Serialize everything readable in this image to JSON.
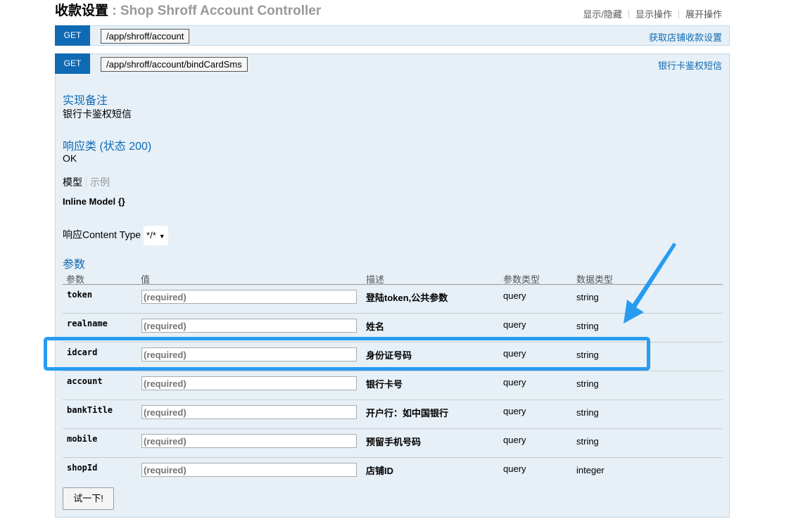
{
  "header": {
    "title_cn": "收款设置",
    "title_sep": " : ",
    "title_en": "Shop Shroff Account Controller",
    "links": [
      "显示/隐藏",
      "显示操作",
      "展开操作"
    ]
  },
  "operations": [
    {
      "method": "GET",
      "path": "/app/shroff/account",
      "summary": "获取店铺收款设置"
    },
    {
      "method": "GET",
      "path": "/app/shroff/account/bindCardSms",
      "summary": "银行卡鉴权短信"
    }
  ],
  "details": {
    "notes_heading": "实现备注",
    "notes_text": "银行卡鉴权短信",
    "response_heading": "响应类 (状态 200)",
    "response_text": "OK",
    "tab_model": "模型",
    "tab_example": "示例",
    "model_text": "Inline Model {}",
    "content_type_label": "响应Content Type",
    "content_type_value": "*/*",
    "params_heading": "参数",
    "try_button": "试一下!"
  },
  "param_columns": [
    "参数",
    "值",
    "描述",
    "参数类型",
    "数据类型"
  ],
  "params": [
    {
      "name": "token",
      "placeholder": "(required)",
      "desc": "登陆token,公共参数",
      "ptype": "query",
      "dtype": "string"
    },
    {
      "name": "realname",
      "placeholder": "(required)",
      "desc": "姓名",
      "ptype": "query",
      "dtype": "string"
    },
    {
      "name": "idcard",
      "placeholder": "(required)",
      "desc": "身份证号码",
      "ptype": "query",
      "dtype": "string"
    },
    {
      "name": "account",
      "placeholder": "(required)",
      "desc": "银行卡号",
      "ptype": "query",
      "dtype": "string"
    },
    {
      "name": "bankTitle",
      "placeholder": "(required)",
      "desc": "开户行：如中国银行",
      "ptype": "query",
      "dtype": "string"
    },
    {
      "name": "mobile",
      "placeholder": "(required)",
      "desc": "预留手机号码",
      "ptype": "query",
      "dtype": "string"
    },
    {
      "name": "shopId",
      "placeholder": "(required)",
      "desc": "店铺ID",
      "ptype": "query",
      "dtype": "integer"
    }
  ],
  "colors": {
    "get_verb": "#0f6ab4",
    "panel_bg": "#e7f0f7",
    "highlight": "#279bf0"
  },
  "icons": [
    "chevron-down-icon",
    "annotation-arrow-icon"
  ]
}
